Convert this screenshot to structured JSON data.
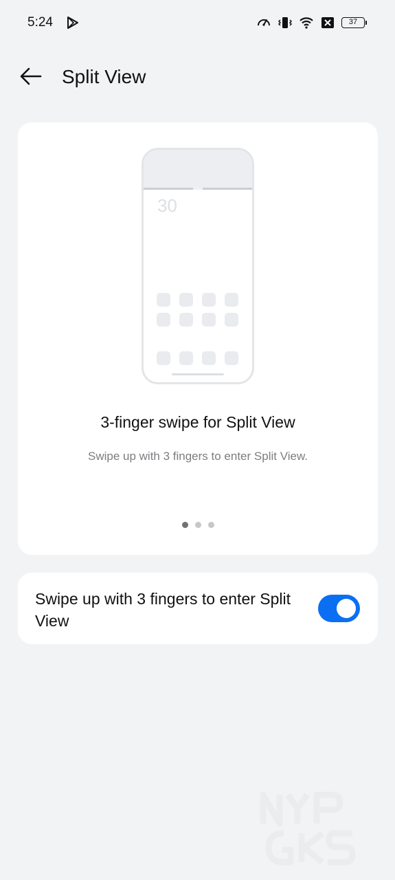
{
  "status_bar": {
    "time": "5:24",
    "battery_level": "37",
    "icons": [
      "play-store-icon",
      "speedometer-icon",
      "vibrate-icon",
      "wifi-icon",
      "x-box-icon",
      "battery-icon"
    ]
  },
  "header": {
    "title": "Split View"
  },
  "illustration": {
    "clock_text": "30"
  },
  "feature": {
    "title": "3-finger swipe for Split View",
    "description": "Swipe up with 3 fingers to enter Split View.",
    "page_count": 3,
    "current_page": 1
  },
  "setting": {
    "label": "Swipe up with 3 fingers to enter Split View",
    "enabled": true
  },
  "watermark": {
    "text": "NYP GKS"
  },
  "colors": {
    "background": "#f2f3f5",
    "accent": "#0b6ff3",
    "card": "#ffffff"
  }
}
